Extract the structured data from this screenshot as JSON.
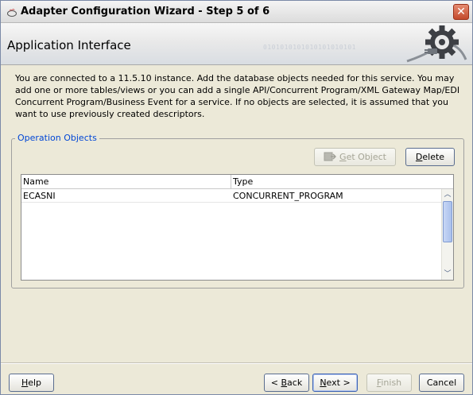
{
  "window": {
    "title": "Adapter Configuration Wizard - Step 5 of 6",
    "close_glyph": "✕"
  },
  "header": {
    "title": "Application Interface",
    "binary_text": "0101010101010101010101",
    "graphic": "gear-plug-icon"
  },
  "description": "You are connected to a 11.5.10 instance. Add the database objects needed for this service. You may add one or more tables/views or you can add a single API/Concurrent Program/XML Gateway Map/EDI Concurrent Program/Business Event for a service. If no objects are selected, it is assumed that you want to use previously created descriptors.",
  "operation_objects": {
    "legend": "Operation Objects",
    "get_object_prefix": "",
    "get_object_mnemonic": "G",
    "get_object_rest": "et Object",
    "get_object_enabled": false,
    "delete_mnemonic": "D",
    "delete_rest": "elete",
    "columns": [
      "Name",
      "Type"
    ],
    "rows": [
      {
        "name": "ECASNI",
        "type": "CONCURRENT_PROGRAM"
      }
    ]
  },
  "footer": {
    "help_mnemonic": "H",
    "help_rest": "elp",
    "back_prefix": "< ",
    "back_mnemonic": "B",
    "back_rest": "ack",
    "next_mnemonic": "N",
    "next_rest": "ext >",
    "finish_mnemonic": "F",
    "finish_rest": "inish",
    "cancel_label": "Cancel"
  },
  "colors": {
    "legend": "#0046d5",
    "window_bg": "#ece9d8",
    "close_button": "#c44a2c"
  }
}
